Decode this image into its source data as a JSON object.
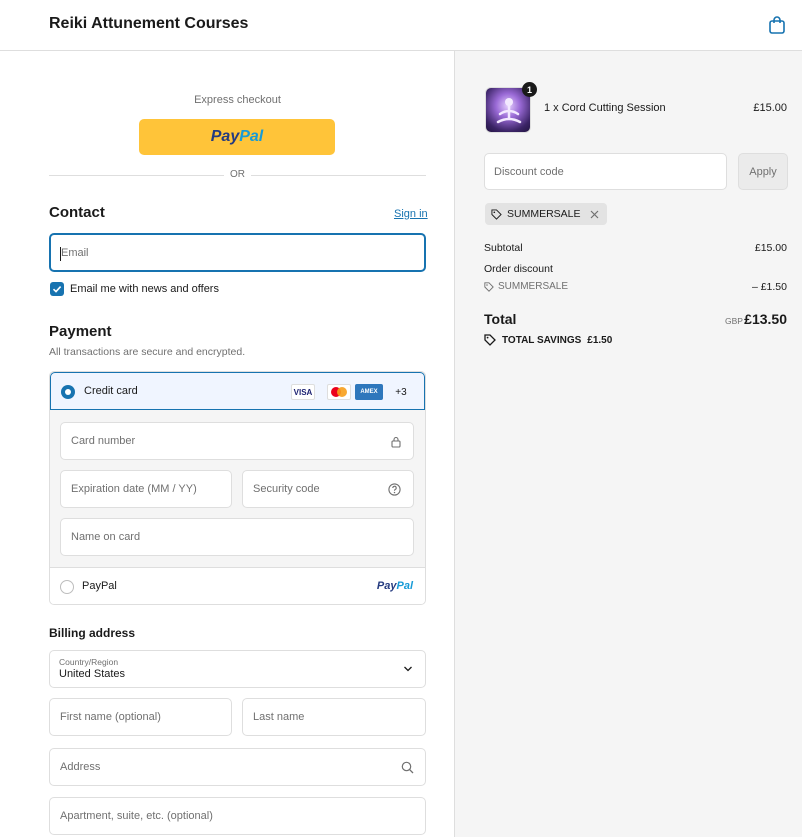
{
  "header": {
    "store_title": "Reiki Attunement Courses",
    "cart_icon": "shopping-bag-icon"
  },
  "express": {
    "label": "Express checkout",
    "paypal_a": "Pay",
    "paypal_b": "Pal",
    "or_text": "OR"
  },
  "contact": {
    "heading": "Contact",
    "sign_in": "Sign in",
    "email_placeholder": "Email",
    "newsletter_label": "Email me with news and offers",
    "newsletter_checked": true
  },
  "payment": {
    "heading": "Payment",
    "subtitle": "All transactions are secure and encrypted.",
    "credit_card": {
      "label": "Credit card",
      "selected": true,
      "logos": [
        "VISA",
        "mastercard",
        "AMEX",
        "+3"
      ],
      "card_number_placeholder": "Card number",
      "expiration_placeholder": "Expiration date (MM / YY)",
      "security_placeholder": "Security code",
      "name_placeholder": "Name on card"
    },
    "paypal": {
      "label": "PayPal",
      "logo_a": "Pay",
      "logo_b": "Pal",
      "selected": false
    }
  },
  "billing": {
    "heading": "Billing address",
    "country_label": "Country/Region",
    "country_value": "United States",
    "first_name_placeholder": "First name (optional)",
    "last_name_placeholder": "Last name",
    "address_placeholder": "Address",
    "apartment_placeholder": "Apartment, suite, etc. (optional)"
  },
  "summary": {
    "item": {
      "quantity": "1",
      "name": "1 x Cord Cutting Session",
      "price": "£15.00"
    },
    "discount_placeholder": "Discount code",
    "apply_label": "Apply",
    "applied_code": "SUMMERSALE",
    "subtotal_label": "Subtotal",
    "subtotal_value": "£15.00",
    "order_discount_label": "Order discount",
    "discount_code": "SUMMERSALE",
    "discount_value": "– £1.50",
    "total_label": "Total",
    "currency": "GBP",
    "total_value": "£13.50",
    "savings_label": "TOTAL SAVINGS",
    "savings_value": "£1.50"
  },
  "colors": {
    "accent": "#1773b0",
    "paypal_yellow": "#ffc439",
    "summary_bg": "#f5f5f5"
  }
}
